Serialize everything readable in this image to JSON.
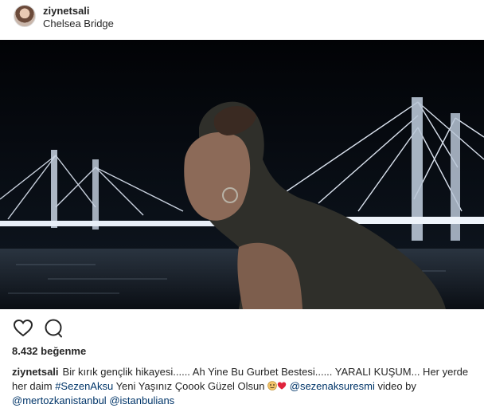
{
  "header": {
    "avatar_icon": "profile-avatar",
    "username": "ziynetsali",
    "location": "Chelsea Bridge"
  },
  "photo": {
    "description_icon": "post-photo",
    "bg_color": "#05070b"
  },
  "actions": {
    "like_icon": "heart-outline-icon",
    "comment_icon": "comment-bubble-icon"
  },
  "likes": {
    "text": "8.432 beğenme"
  },
  "caption": {
    "username": "ziynetsali",
    "text1": "Bir kırık gençlik hikayesi...... Ah Yine Bu Gurbet Bestesi...... YARALI KUŞUM... Her yerde her daim ",
    "hashtag": "#SezenAksu",
    "text2": " Yeni Yaşınız Çoook Güzel Olsun ",
    "mention1": "@sezenaksuresmi",
    "text3": " video by ",
    "mention2": "@mertozkanistanbul",
    "mention3": "@istanbulians",
    "emoji1": "face-emoji",
    "emoji2": "red-heart-emoji"
  },
  "colors": {
    "text": "#262626",
    "link": "#003569",
    "heart": "#e0233c"
  }
}
